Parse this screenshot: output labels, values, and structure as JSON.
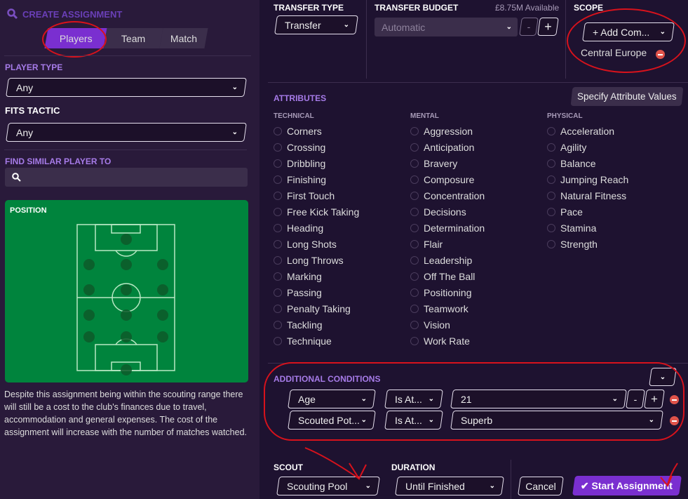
{
  "header": {
    "title": "CREATE ASSIGNMENT",
    "icon": "search-icon"
  },
  "tabs": [
    {
      "label": "Players",
      "active": true
    },
    {
      "label": "Team"
    },
    {
      "label": "Match"
    }
  ],
  "player_type": {
    "label": "PLAYER TYPE",
    "value": "Any"
  },
  "fits_tactic": {
    "label": "FITS TACTIC",
    "value": "Any"
  },
  "find_similar": {
    "label": "FIND SIMILAR PLAYER TO",
    "placeholder": ""
  },
  "position": {
    "label": "POSITION"
  },
  "note": "Despite this assignment being within the scouting range there will still be a cost to the club's finances due to travel, accommodation and general expenses. The cost of the assignment will increase with the number of matches watched.",
  "transfer_type": {
    "label": "TRANSFER TYPE",
    "value": "Transfer"
  },
  "transfer_budget": {
    "label": "TRANSFER BUDGET",
    "available": "£8.75M Available",
    "value": "Automatic",
    "minus": "-",
    "plus": "+"
  },
  "scope": {
    "label": "SCOPE",
    "add_button": "Add Com...",
    "items": [
      "Central Europe"
    ]
  },
  "attributes": {
    "label": "ATTRIBUTES",
    "specify_button": "Specify Attribute Values",
    "columns": [
      {
        "label": "TECHNICAL",
        "items": [
          "Corners",
          "Crossing",
          "Dribbling",
          "Finishing",
          "First Touch",
          "Free Kick Taking",
          "Heading",
          "Long Shots",
          "Long Throws",
          "Marking",
          "Passing",
          "Penalty Taking",
          "Tackling",
          "Technique"
        ]
      },
      {
        "label": "MENTAL",
        "items": [
          "Aggression",
          "Anticipation",
          "Bravery",
          "Composure",
          "Concentration",
          "Decisions",
          "Determination",
          "Flair",
          "Leadership",
          "Off The Ball",
          "Positioning",
          "Teamwork",
          "Vision",
          "Work Rate"
        ]
      },
      {
        "label": "PHYSICAL",
        "items": [
          "Acceleration",
          "Agility",
          "Balance",
          "Jumping Reach",
          "Natural Fitness",
          "Pace",
          "Stamina",
          "Strength"
        ]
      }
    ]
  },
  "conditions": {
    "label": "ADDITIONAL CONDITIONS",
    "rows": [
      {
        "field": "Age",
        "op": "Is At...",
        "value": "21",
        "minus": "-",
        "plus": "+"
      },
      {
        "field": "Scouted Pot...",
        "op": "Is At...",
        "value": "Superb"
      }
    ]
  },
  "scout": {
    "label": "SCOUT",
    "value": "Scouting Pool"
  },
  "duration": {
    "label": "DURATION",
    "value": "Until Finished"
  },
  "actions": {
    "cancel": "Cancel",
    "start": "Start Assignment"
  },
  "colors": {
    "accent": "#7a2fd0",
    "pitch": "#00843d",
    "label_purple": "#a67be8",
    "remove": "#e0534a"
  }
}
